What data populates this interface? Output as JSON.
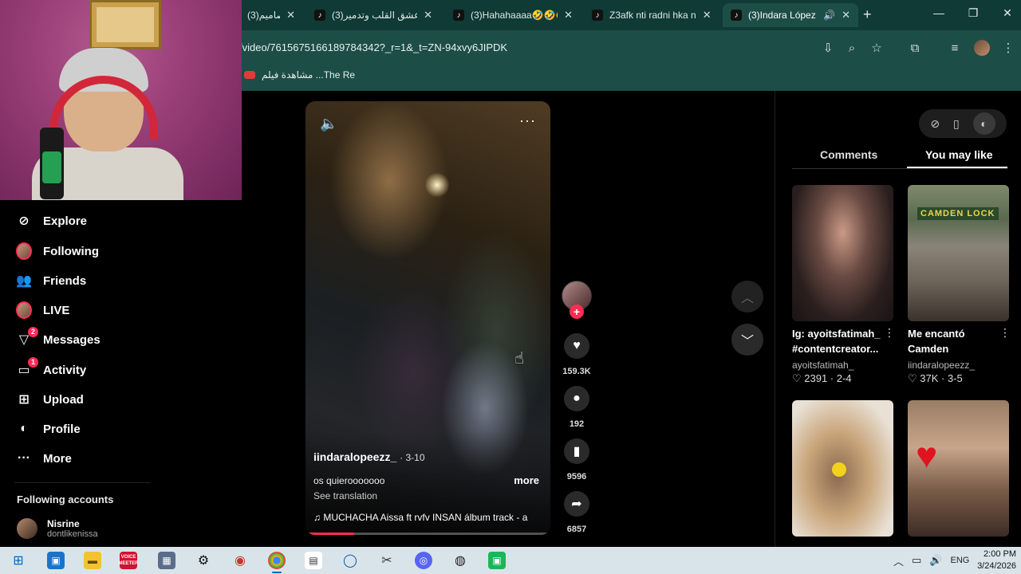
{
  "browser": {
    "tabs": [
      {
        "label": "تصاميم(3)",
        "icon": "tiktok-icon",
        "active": false
      },
      {
        "label": "(3)عشق القلب وتدمير",
        "icon": "tiktok-icon",
        "active": false
      },
      {
        "label": "(3)Hahahaaaa🤣🤣🤣",
        "icon": "tiktok-icon",
        "active": false
      },
      {
        "label": "Z3afk nti radni hka n",
        "icon": "tiktok-icon",
        "active": false
      },
      {
        "label": "(3)Indara López y",
        "icon": "tiktok-icon",
        "active": true
      }
    ],
    "url": "/video/7615675166189784342?_r=1&_t=ZN-94xvy6JIPDK",
    "bookmark": "مشاهدة فيلم ...The Re"
  },
  "sidebar": {
    "items": [
      {
        "label": "Explore",
        "icon": "compass-icon"
      },
      {
        "label": "Following",
        "icon": "avatar"
      },
      {
        "label": "Friends",
        "icon": "friends-icon"
      },
      {
        "label": "LIVE",
        "icon": "live-avatar"
      },
      {
        "label": "Messages",
        "icon": "messages-icon",
        "badge": "2"
      },
      {
        "label": "Activity",
        "icon": "activity-icon",
        "badge": "1"
      },
      {
        "label": "Upload",
        "icon": "upload-icon"
      },
      {
        "label": "Profile",
        "icon": "profile-icon"
      },
      {
        "label": "More",
        "icon": "more-icon"
      }
    ],
    "following_accounts_title": "Following accounts",
    "account": {
      "name": "Nisrine",
      "username": "dontlikenissa"
    }
  },
  "video": {
    "author": "iindaralopeezz_",
    "date": "· 3-10",
    "caption": "os quierooooooo",
    "more": "more",
    "see_translation": "See translation",
    "music": "♫  MUCHACHA  Aissa ft rvfv INSAN álbum track - a",
    "progress": 0.2
  },
  "actions": {
    "likes": "159.3K",
    "comments": "192",
    "saves": "9596",
    "shares": "6857"
  },
  "right_panel": {
    "tab_comments": "Comments",
    "tab_you_may_like": "You may like",
    "cards": [
      {
        "title": "Ig: ayoitsfatimah_ #contentcreator...",
        "user": "ayoitsfatimah_",
        "stats": "♡ 2391 · 2-4"
      },
      {
        "title": "Me encantó Camden",
        "user": "iindaralopeezz_",
        "stats": "♡ 37K · 3-5"
      },
      {
        "title": "",
        "user": "",
        "stats": ""
      },
      {
        "title": "",
        "user": "",
        "stats": ""
      }
    ],
    "thumb_text_2": "CAMDEN LOCK"
  },
  "taskbar": {
    "language": "ENG",
    "time": "2:00 PM",
    "date": "3/24/2026",
    "voice_label": "VOICE MEETER"
  },
  "colors": {
    "accent": "#fe2c55",
    "chrome": "#1d4d47",
    "taskbar": "#d9e4ea"
  }
}
